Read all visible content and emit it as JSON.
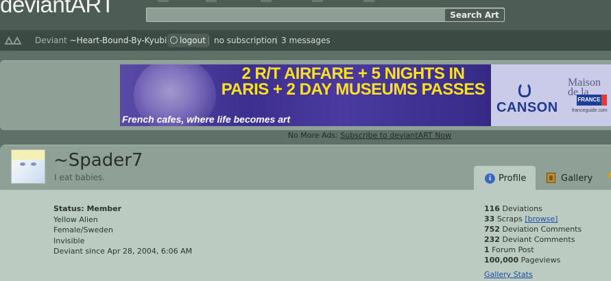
{
  "header": {
    "logo_text": "deviantART",
    "search_button_label": "Search Art",
    "search_value": ""
  },
  "userbar": {
    "prefix": "Deviant",
    "username": "~Heart-Bound-By-Kyubi",
    "logout_label": "logout",
    "subscription_text": "no subscription",
    "messages_text": "3 messages"
  },
  "ad": {
    "headline_line1": "2 R/T AIRFARE + 5 NIGHTS IN",
    "headline_line2": "PARIS + 2 DAY MUSEUMS PASSES",
    "tagline": "French cafes, where life becomes art",
    "brand": "CANSON",
    "maison_line1": "Maison",
    "maison_line2": "de la",
    "badge_text": "FRANCE",
    "site": "franceguide.com"
  },
  "no_more_ads": {
    "prefix": "No More Ads:",
    "link_text": "Subscribe to deviantART Now"
  },
  "profile": {
    "username": "~Spader7",
    "tagline": "I eat babies.",
    "tabs": [
      {
        "label": "Profile",
        "icon": "info-icon",
        "active": true
      },
      {
        "label": "Gallery",
        "icon": "gallery-icon",
        "active": false
      }
    ],
    "info": {
      "status": "Status: Member",
      "lines": [
        "Yellow Alien",
        "Female/Sweden",
        "Invisible",
        "Deviant since Apr 28, 2004, 6:06 AM"
      ]
    },
    "stats": [
      {
        "value": "116",
        "label": "Deviations"
      },
      {
        "value": "33",
        "label": "Scraps"
      },
      {
        "value": "752",
        "label": "Deviation Comments"
      },
      {
        "value": "232",
        "label": "Deviant Comments"
      },
      {
        "value": "1",
        "label": "Forum Post"
      },
      {
        "value": "100,000",
        "label": "Pageviews"
      }
    ],
    "browse_label": "[browse]",
    "gallery_stats_link": "Gallery Stats"
  },
  "colors": {
    "background": "#5f7068",
    "topbar": "#4d5d56",
    "userbar": "#3c4a44",
    "panel": "#8fa096",
    "profile_body": "#bccbc1",
    "link": "#1b4da5",
    "ad_headline": "#ffe21c"
  }
}
